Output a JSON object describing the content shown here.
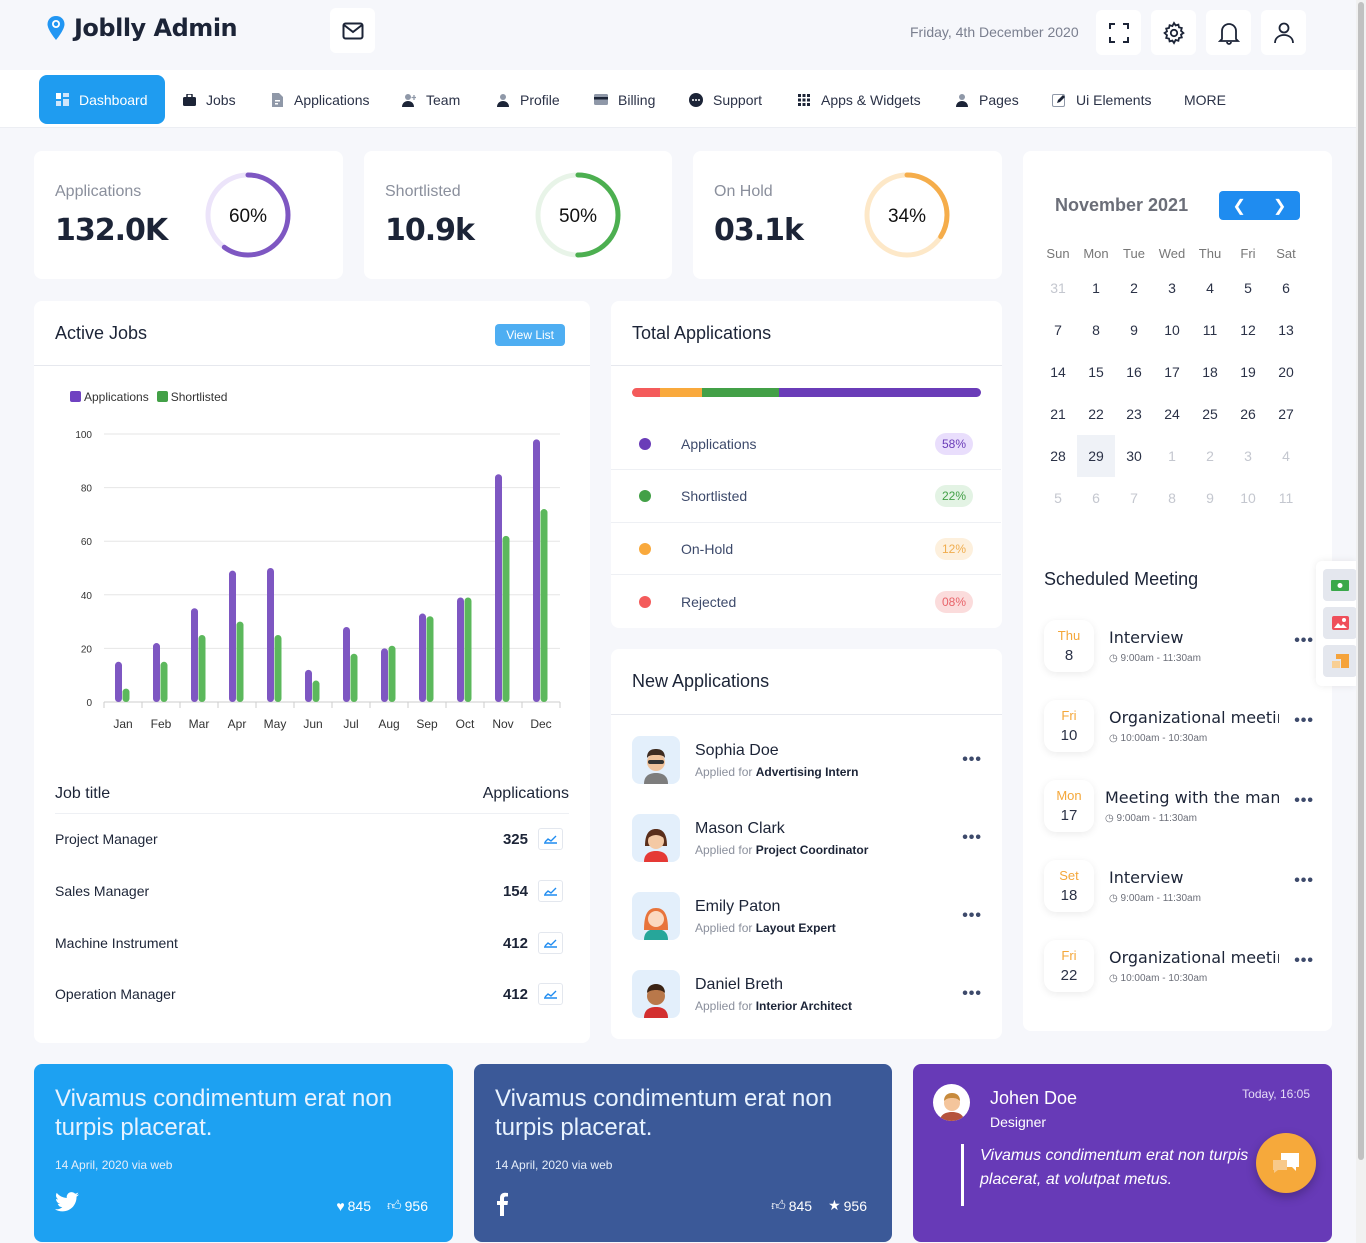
{
  "app": {
    "title": "Joblly Admin",
    "date": "Friday, 4th December 2020"
  },
  "header_icons": [
    "mail-icon",
    "fullscreen-icon",
    "gear-icon",
    "bell-icon",
    "user-icon"
  ],
  "nav": [
    {
      "label": "Dashboard",
      "icon": "dashboard-icon",
      "active": true
    },
    {
      "label": "Jobs",
      "icon": "briefcase-icon"
    },
    {
      "label": "Applications",
      "icon": "document-icon"
    },
    {
      "label": "Team",
      "icon": "user-plus-icon"
    },
    {
      "label": "Profile",
      "icon": "person-icon"
    },
    {
      "label": "Billing",
      "icon": "credit-card-icon"
    },
    {
      "label": "Support",
      "icon": "chat-icon"
    },
    {
      "label": "Apps & Widgets",
      "icon": "grid-icon"
    },
    {
      "label": "Pages",
      "icon": "person-icon"
    },
    {
      "label": "Ui Elements",
      "icon": "edit-icon"
    },
    {
      "label": "MORE"
    }
  ],
  "stats": [
    {
      "label": "Applications",
      "value": "132.0K",
      "percent": 60,
      "percent_label": "60%",
      "color": "#7e57c2",
      "track": "#ece4fa"
    },
    {
      "label": "Shortlisted",
      "value": "10.9k",
      "percent": 50,
      "percent_label": "50%",
      "color": "#4caf50",
      "track": "#e8f4e8"
    },
    {
      "label": "On Hold",
      "value": "03.1k",
      "percent": 34,
      "percent_label": "34%",
      "color": "#f5ad4b",
      "track": "#fde8c8"
    }
  ],
  "active_jobs": {
    "title": "Active Jobs",
    "view_list": "View List",
    "table_headers": {
      "job": "Job title",
      "apps": "Applications"
    },
    "rows": [
      {
        "title": "Project Manager",
        "count": "325"
      },
      {
        "title": "Sales Manager",
        "count": "154"
      },
      {
        "title": "Machine Instrument",
        "count": "412"
      },
      {
        "title": "Operation Manager",
        "count": "412"
      }
    ]
  },
  "chart_data": {
    "type": "bar",
    "title": "",
    "xlabel": "",
    "ylabel": "",
    "categories": [
      "Jan",
      "Feb",
      "Mar",
      "Apr",
      "May",
      "Jun",
      "Jul",
      "Aug",
      "Sep",
      "Oct",
      "Nov",
      "Dec"
    ],
    "series": [
      {
        "name": "Applications",
        "color": "#7e57c2",
        "values": [
          15,
          22,
          35,
          49,
          50,
          12,
          28,
          20,
          33,
          39,
          85,
          98
        ]
      },
      {
        "name": "Shortlisted",
        "color": "#5cb85c",
        "values": [
          5,
          15,
          25,
          30,
          25,
          8,
          18,
          21,
          32,
          39,
          62,
          72
        ]
      }
    ],
    "ylim": [
      0,
      100
    ],
    "yticks": [
      0,
      20,
      40,
      60,
      80,
      100
    ],
    "grid": true,
    "legend": "top-left"
  },
  "total_applications": {
    "title": "Total Applications",
    "segments": [
      {
        "label": "Rejected",
        "percent": 8,
        "color": "#f45b5b"
      },
      {
        "label": "On-Hold",
        "percent": 12,
        "color": "#f9a93c"
      },
      {
        "label": "Shortlisted",
        "percent": 22,
        "color": "#43a047"
      },
      {
        "label": "Applications",
        "percent": 58,
        "color": "#6a3cb8"
      }
    ],
    "rows": [
      {
        "label": "Applications",
        "badge": "58%",
        "color": "#6a3cb8",
        "bg": "#e9defc",
        "fg": "#6a3cb8"
      },
      {
        "label": "Shortlisted",
        "badge": "22%",
        "color": "#43a047",
        "bg": "#e3f3e4",
        "fg": "#43a047"
      },
      {
        "label": "On-Hold",
        "badge": "12%",
        "color": "#f9a93c",
        "bg": "#fdf0dd",
        "fg": "#f0ad4e"
      },
      {
        "label": "Rejected",
        "badge": "08%",
        "color": "#f45b5b",
        "bg": "#fbdcdc",
        "fg": "#e8646a"
      }
    ]
  },
  "new_applications": {
    "title": "New Applications",
    "applied_for_label": "Applied for",
    "items": [
      {
        "name": "Sophia Doe",
        "role": "Advertising Intern"
      },
      {
        "name": "Mason Clark",
        "role": "Project Coordinator"
      },
      {
        "name": "Emily Paton",
        "role": "Layout Expert"
      },
      {
        "name": "Daniel Breth",
        "role": "Interior Architect"
      }
    ]
  },
  "calendar": {
    "title": "November 2021",
    "weekdays": [
      "Sun",
      "Mon",
      "Tue",
      "Wed",
      "Thu",
      "Fri",
      "Sat"
    ],
    "days": [
      {
        "d": "31",
        "m": true
      },
      {
        "d": "1"
      },
      {
        "d": "2"
      },
      {
        "d": "3"
      },
      {
        "d": "4"
      },
      {
        "d": "5"
      },
      {
        "d": "6"
      },
      {
        "d": "7"
      },
      {
        "d": "8"
      },
      {
        "d": "9"
      },
      {
        "d": "10"
      },
      {
        "d": "11"
      },
      {
        "d": "12"
      },
      {
        "d": "13"
      },
      {
        "d": "14"
      },
      {
        "d": "15"
      },
      {
        "d": "16"
      },
      {
        "d": "17"
      },
      {
        "d": "18"
      },
      {
        "d": "19"
      },
      {
        "d": "20"
      },
      {
        "d": "21"
      },
      {
        "d": "22"
      },
      {
        "d": "23"
      },
      {
        "d": "24"
      },
      {
        "d": "25"
      },
      {
        "d": "26"
      },
      {
        "d": "27"
      },
      {
        "d": "28"
      },
      {
        "d": "29",
        "s": true
      },
      {
        "d": "30"
      },
      {
        "d": "1",
        "m": true
      },
      {
        "d": "2",
        "m": true
      },
      {
        "d": "3",
        "m": true
      },
      {
        "d": "4",
        "m": true
      },
      {
        "d": "5",
        "m": true
      },
      {
        "d": "6",
        "m": true
      },
      {
        "d": "7",
        "m": true
      },
      {
        "d": "8",
        "m": true
      },
      {
        "d": "9",
        "m": true
      },
      {
        "d": "10",
        "m": true
      },
      {
        "d": "11",
        "m": true
      }
    ]
  },
  "meetings": {
    "title": "Scheduled Meeting",
    "items": [
      {
        "day": "Thu",
        "num": "8",
        "title": "Interview",
        "time": "9:00am - 11:30am"
      },
      {
        "day": "Fri",
        "num": "10",
        "title": "Organizational meeting",
        "time": "10:00am - 10:30am"
      },
      {
        "day": "Mon",
        "num": "17",
        "title": "Meeting with the manager",
        "time": "9:00am - 11:30am"
      },
      {
        "day": "Set",
        "num": "18",
        "title": "Interview",
        "time": "9:00am - 11:30am"
      },
      {
        "day": "Fri",
        "num": "22",
        "title": "Organizational meeting",
        "time": "10:00am - 10:30am"
      }
    ]
  },
  "social": [
    {
      "network": "twitter",
      "text": "Vivamus condimentum erat non turpis placerat.",
      "date": "14 April, 2020 via web",
      "stat1": "845",
      "stat2": "956",
      "color": "#1da1f2"
    },
    {
      "network": "facebook",
      "text": "Vivamus condimentum erat non turpis placerat.",
      "date": "14 April, 2020 via web",
      "stat1": "845",
      "stat2": "956",
      "color": "#3b5998"
    }
  ],
  "testimonial": {
    "name": "Johen Doe",
    "role": "Designer",
    "time": "Today, 16:05",
    "quote": "Vivamus condimentum erat non turpis placerat, at volutpat metus.",
    "color": "#673ab7"
  }
}
